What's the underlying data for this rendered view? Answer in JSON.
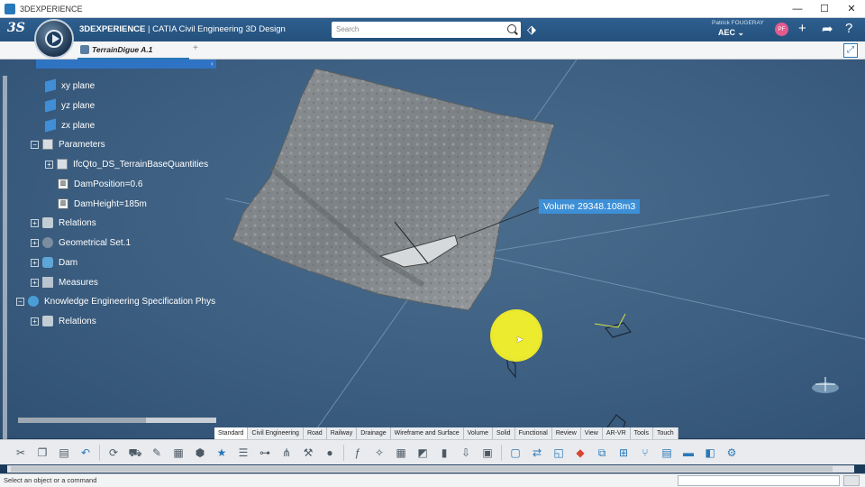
{
  "window": {
    "title": "3DEXPERIENCE",
    "controls": [
      "—",
      "☐",
      "✕"
    ]
  },
  "header": {
    "brand_bold": "3DEXPERIENCE",
    "brand_rest": " | CATIA Civil Engineering 3D Design",
    "search_placeholder": "Search",
    "user_name": "Patrick FOUGERAY",
    "role": "AEC ⌄",
    "avatar_initials": "PF",
    "icons": [
      "compass-icon",
      "search-icon",
      "tag-icon",
      "plus-icon",
      "share-icon",
      "help-icon"
    ]
  },
  "tabs": {
    "document": "TerrainDigue A.1",
    "add": "+"
  },
  "tree": {
    "items": [
      {
        "label": "xy plane",
        "icon": "plane-icon"
      },
      {
        "label": "yz plane",
        "icon": "plane-icon"
      },
      {
        "label": "zx plane",
        "icon": "plane-icon"
      },
      {
        "label": "Parameters",
        "icon": "parameters-icon"
      },
      {
        "label": "IfcQto_DS_TerrainBaseQuantities",
        "icon": "parameters-icon"
      },
      {
        "label": "DamPosition=0.6",
        "icon": "formula-icon"
      },
      {
        "label": "DamHeight=185m",
        "icon": "formula-icon"
      },
      {
        "label": "Relations",
        "icon": "relations-icon"
      },
      {
        "label": "Geometrical Set.1",
        "icon": "geometrical-set-icon"
      },
      {
        "label": "Dam",
        "icon": "dam-icon"
      },
      {
        "label": "Measures",
        "icon": "measures-icon"
      },
      {
        "label": "Knowledge Engineering Specification Phys",
        "icon": "knowledge-icon"
      },
      {
        "label": "Relations",
        "icon": "relations-icon"
      }
    ]
  },
  "viewport": {
    "volume_label": "Volume 29348.108m3"
  },
  "section_tabs": [
    "Standard",
    "Civil Engineering",
    "Road",
    "Railway",
    "Drainage",
    "Wireframe and Surface",
    "Volume",
    "Solid",
    "Functional",
    "Review",
    "View",
    "AR-VR",
    "Tools",
    "Touch"
  ],
  "active_section_tab": "Standard",
  "status": {
    "text": "Select an object or a command"
  },
  "colors": {
    "header": "#2e5f8f",
    "accent": "#2a78b8",
    "volume_label_bg": "#3d8fd6",
    "cursor_highlight": "#f6f22a"
  }
}
